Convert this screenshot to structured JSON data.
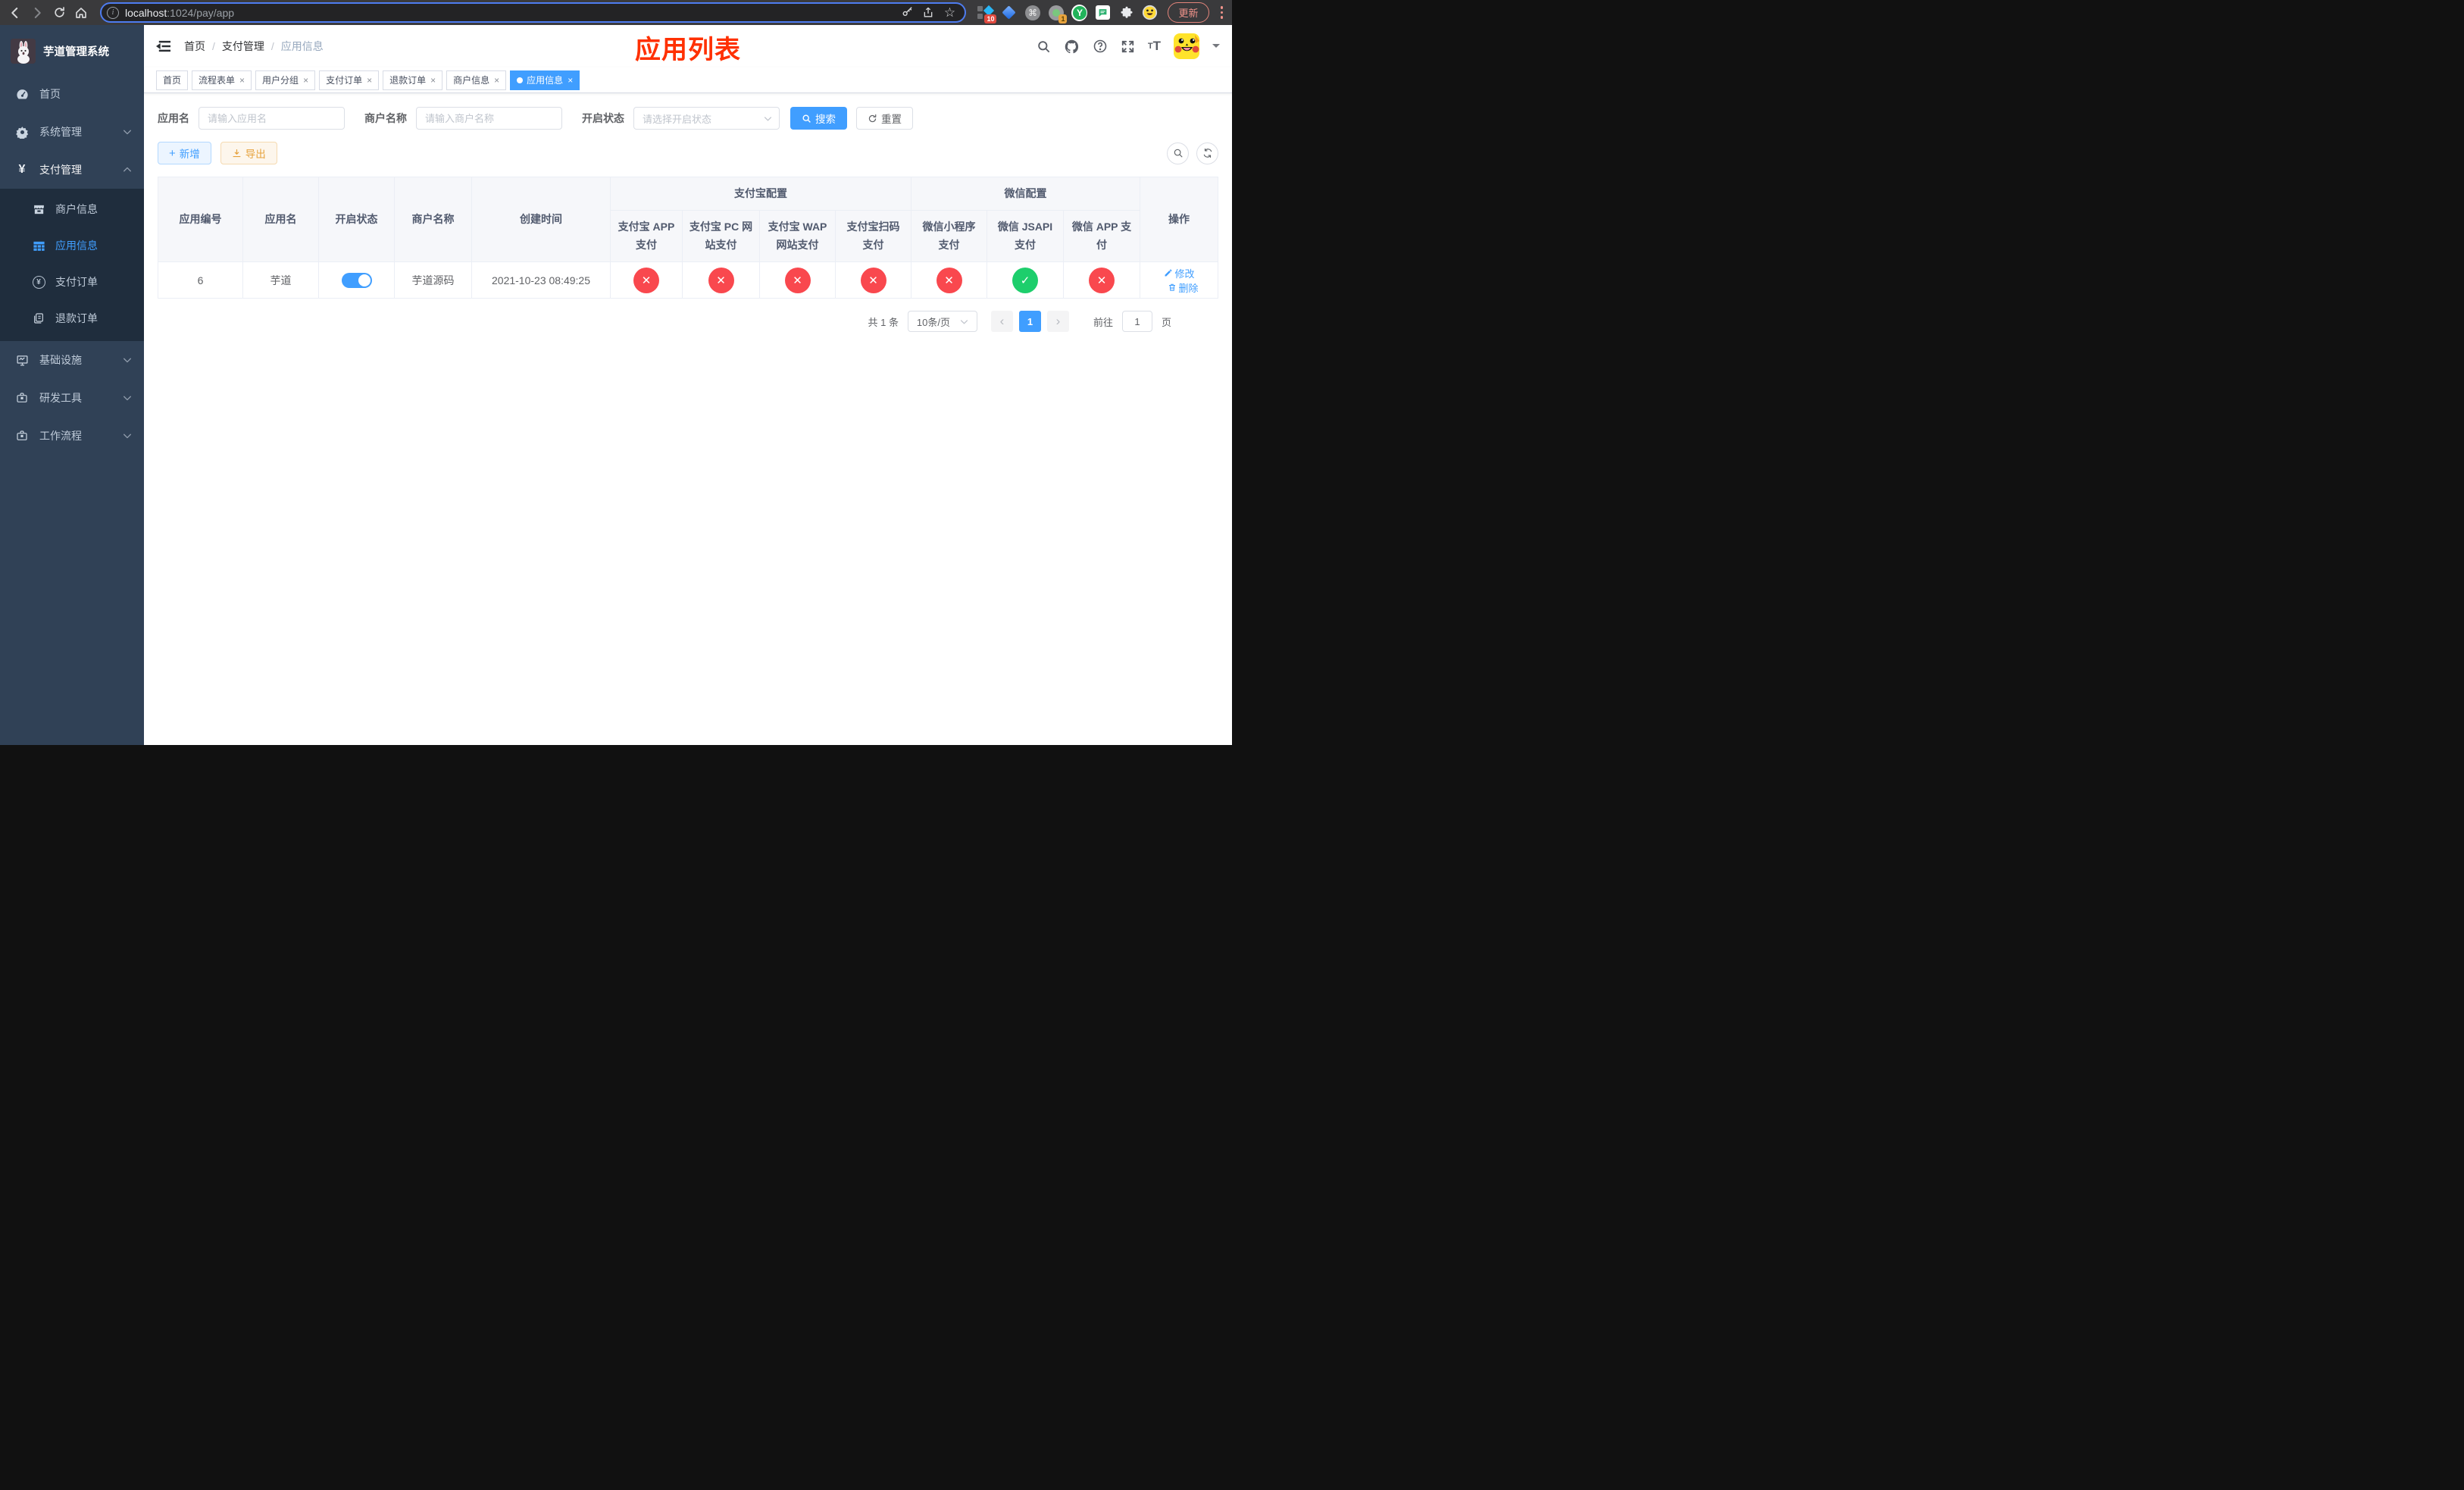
{
  "colors": {
    "accent": "#409eff",
    "success": "#1dce6c",
    "danger": "#f9484e",
    "warning": "#e6a23c",
    "page_title_red": "#ff3000",
    "sidebar_bg": "#304156",
    "submenu_bg": "#1f2d3d",
    "browser_update_red": "#f2948b"
  },
  "icons": {
    "check": "✓",
    "cross": "✕",
    "close": "×",
    "prev": "‹",
    "next": "›",
    "plus": "+",
    "star": "☆",
    "command": "⌘",
    "info": "i",
    "question": "?",
    "y_letter": "Y"
  },
  "browser": {
    "url_host": "localhost",
    "url_path": ":1024/pay/app",
    "update_label": "更新",
    "devtools_badge": "10",
    "proxy_badge": "1"
  },
  "sidebar": {
    "logo_title": "芋道管理系统",
    "item_home": "首页",
    "item_system": "系统管理",
    "item_pay": "支付管理",
    "item_infra": "基础设施",
    "item_devtools": "研发工具",
    "item_workflow": "工作流程",
    "sub_merchant": "商户信息",
    "sub_app": "应用信息",
    "sub_pay_order": "支付订单",
    "sub_refund_order": "退款订单"
  },
  "navbar": {
    "breadcrumb": [
      "首页",
      "支付管理",
      "应用信息"
    ]
  },
  "page_title": "应用列表",
  "tags": [
    {
      "label": "首页"
    },
    {
      "label": "流程表单"
    },
    {
      "label": "用户分组"
    },
    {
      "label": "支付订单"
    },
    {
      "label": "退款订单"
    },
    {
      "label": "商户信息"
    },
    {
      "label": "应用信息"
    }
  ],
  "filters": {
    "app_name_label": "应用名",
    "app_name_placeholder": "请输入应用名",
    "merchant_label": "商户名称",
    "merchant_placeholder": "请输入商户名称",
    "status_label": "开启状态",
    "status_placeholder": "请选择开启状态",
    "search_label": "搜索",
    "reset_label": "重置"
  },
  "toolbar": {
    "add_label": "新增",
    "export_label": "导出"
  },
  "table": {
    "columns": {
      "app_id": "应用编号",
      "app_name": "应用名",
      "status": "开启状态",
      "merchant": "商户名称",
      "created": "创建时间",
      "alipay_group": "支付宝配置",
      "wechat_group": "微信配置",
      "actions": "操作",
      "alipay_app": "支付宝 APP 支付",
      "alipay_pc": "支付宝 PC 网站支付",
      "alipay_wap": "支付宝 WAP 网站支付",
      "alipay_qr": "支付宝扫码支付",
      "wx_lite": "微信小程序支付",
      "wx_jsapi": "微信 JSAPI 支付",
      "wx_app": "微信 APP 支付"
    },
    "row": {
      "app_id": "6",
      "app_name": "芋道",
      "status_on": true,
      "merchant": "芋道源码",
      "created": "2021-10-23 08:49:25",
      "alipay_app": false,
      "alipay_pc": false,
      "alipay_wap": false,
      "alipay_qr": false,
      "wx_lite": false,
      "wx_jsapi": true,
      "wx_app": false,
      "edit_label": "修改",
      "delete_label": "删除"
    }
  },
  "pagination": {
    "total": "共 1 条",
    "page_size": "10条/页",
    "page": "1",
    "goto_label": "前往",
    "goto_value": "1",
    "page_suffix": "页"
  }
}
